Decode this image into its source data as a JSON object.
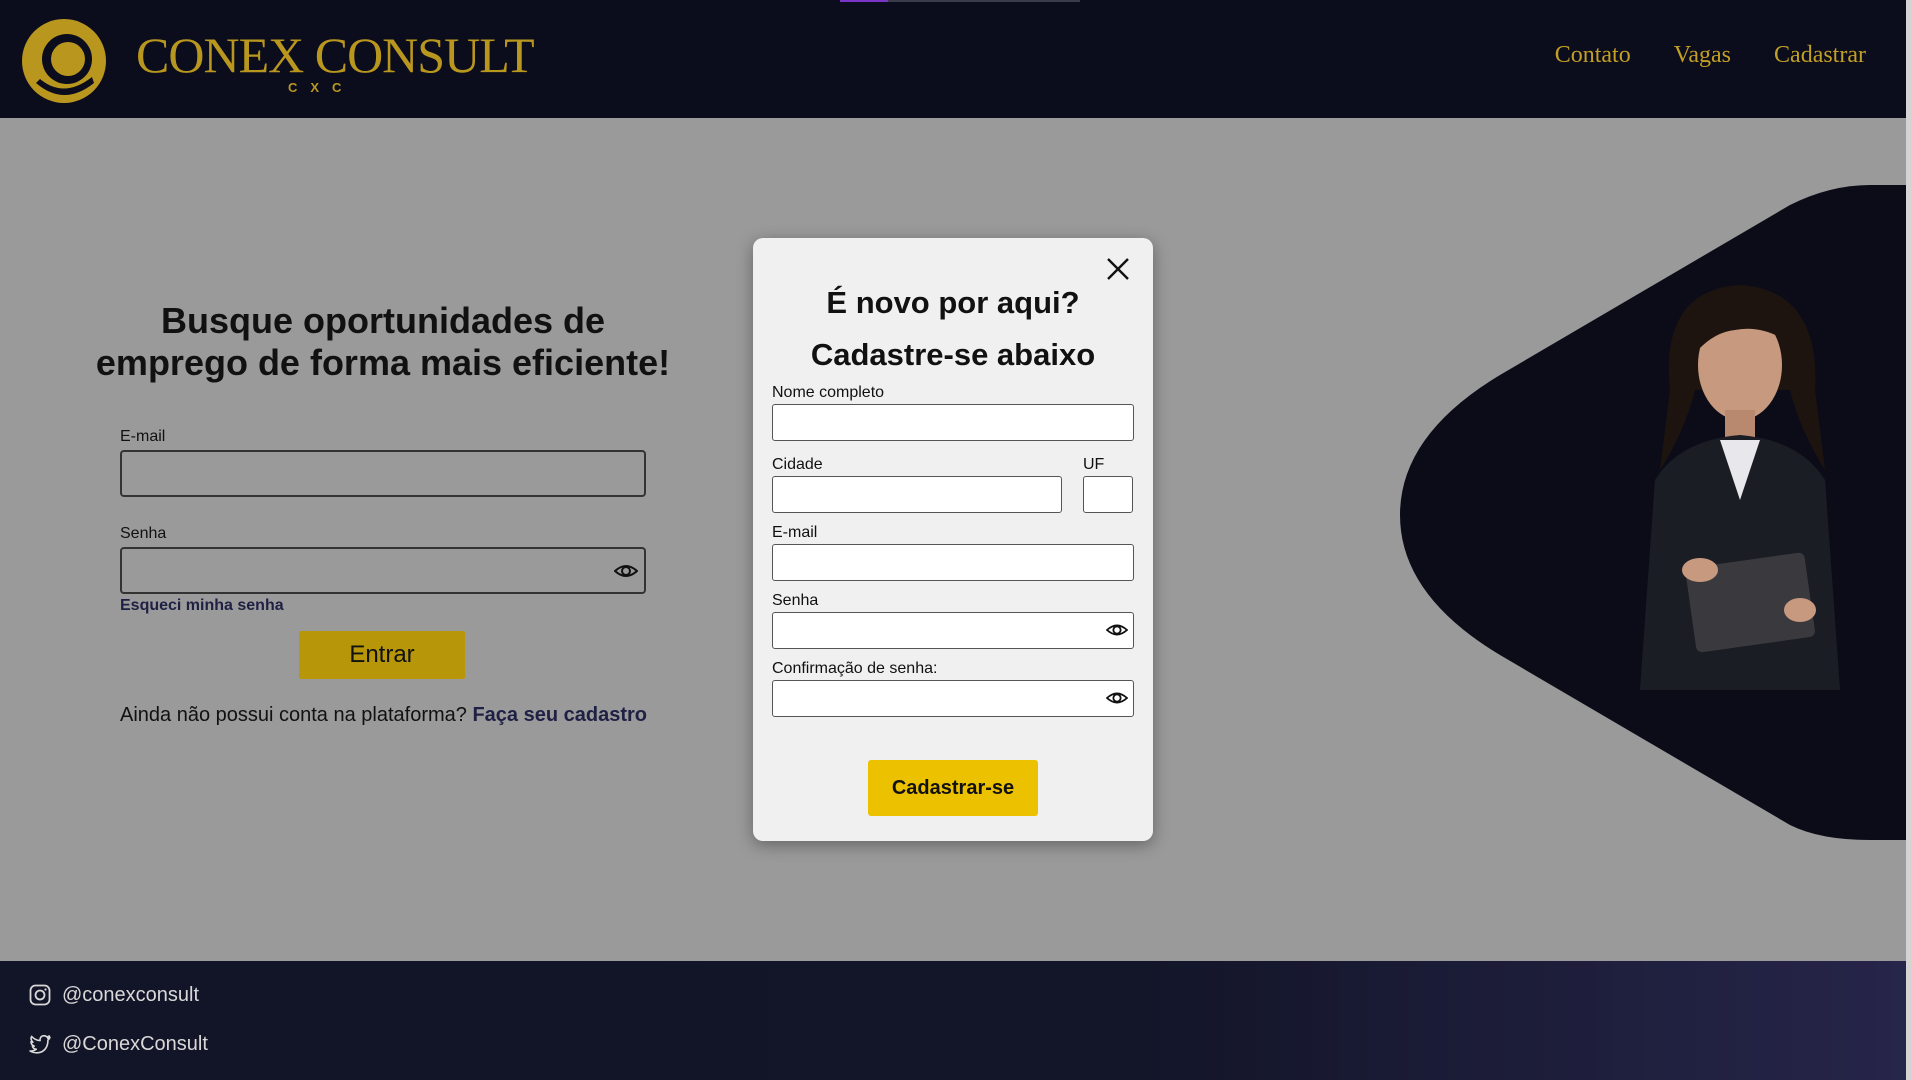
{
  "header": {
    "brand_name": "CONEX CONSULT",
    "brand_sub": "CXC",
    "nav": [
      "Contato",
      "Vagas",
      "Cadastrar"
    ],
    "progress_percent": 20
  },
  "hero": {
    "title": "Busque oportunidades de emprego de forma mais eficiente!"
  },
  "login": {
    "email_label": "E-mail",
    "email_value": "",
    "password_label": "Senha",
    "password_value": "",
    "forgot_link": "Esqueci minha senha",
    "submit_label": "Entrar",
    "signup_prompt": "Ainda não possui conta na plataforma?",
    "signup_link": "Faça seu cadastro"
  },
  "modal": {
    "title": "É novo por aqui?",
    "subtitle": "Cadastre-se abaixo",
    "fields": {
      "full_name": "Nome completo",
      "city": "Cidade",
      "state": "UF",
      "email": "E-mail",
      "password": "Senha",
      "password_confirm": "Confirmação de senha:"
    },
    "submit_label": "Cadastrar-se"
  },
  "footer": {
    "instagram": "@conexconsult",
    "twitter": "@ConexConsult"
  },
  "colors": {
    "header_bg": "#0b0c1c",
    "gold": "#b9971f",
    "button_gold": "#b8960a",
    "modal_button": "#ebc100",
    "overlay_bg": "#9a9a9a",
    "link_dark": "#1e2044"
  }
}
